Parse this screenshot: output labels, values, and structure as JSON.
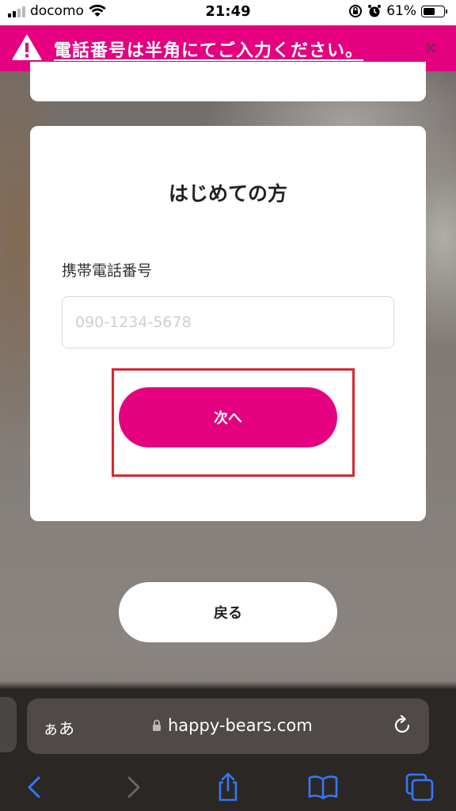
{
  "status_bar": {
    "carrier": "docomo",
    "time": "21:49",
    "battery": "61%",
    "battery_level": 0.61
  },
  "error_banner": {
    "message": "電話番号は半角にてご入力ください。",
    "close": "×",
    "color": "#e4007f"
  },
  "card": {
    "title": "はじめての方",
    "phone_label": "携帯電話番号",
    "phone_placeholder": "090-1234-5678",
    "phone_value": "",
    "next_label": "次へ"
  },
  "back_label": "戻る",
  "safari": {
    "aa_label": "ぁあ",
    "url": "happy-bears.com"
  },
  "colors": {
    "accent": "#e4007f",
    "highlight": "#d9262e",
    "ios_blue": "#3478f6"
  },
  "icons": {
    "wifi": "wifi-icon",
    "alarm": "alarm-icon",
    "rotation_lock": "rotation-lock-icon",
    "warning": "warning-icon",
    "lock": "lock-icon",
    "reload": "reload-icon",
    "back": "chevron-left-icon",
    "forward": "chevron-right-icon",
    "share": "share-icon",
    "bookmarks": "book-icon",
    "tabs": "tabs-icon"
  }
}
